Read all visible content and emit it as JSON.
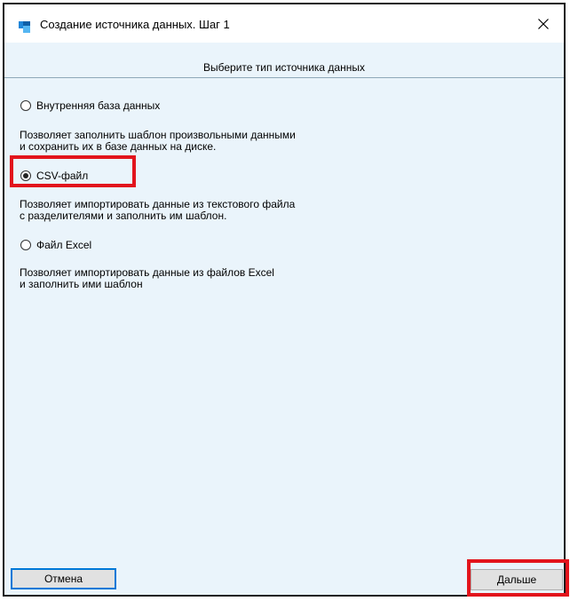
{
  "window": {
    "title": "Создание источника данных. Шаг 1",
    "close_icon": "close-icon"
  },
  "header": {
    "text": "Выберите тип источника данных"
  },
  "options": [
    {
      "label": "Внутренняя база данных",
      "checked": false,
      "description_line1": "Позволяет заполнить шаблон произвольными данными",
      "description_line2": "и сохранить их в базе данных на диске."
    },
    {
      "label": "CSV-файл",
      "checked": true,
      "description_line1": "Позволяет импортировать данные из текстового файла",
      "description_line2": "с разделителями и заполнить им шаблон."
    },
    {
      "label": "Файл Excel",
      "checked": false,
      "description_line1": "Позволяет импортировать данные из файлов Excel",
      "description_line2": "и заполнить ими шаблон"
    }
  ],
  "footer": {
    "cancel_label": "Отмена",
    "next_label": "Дальше"
  },
  "colors": {
    "highlight": "#e2141c",
    "accent": "#0078d7",
    "background": "#eaf4fb"
  }
}
